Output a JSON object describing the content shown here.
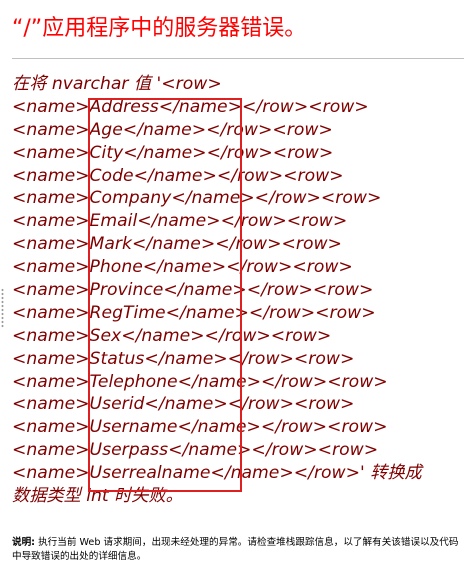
{
  "page": {
    "title": "“/”应用程序中的服务器错误。"
  },
  "error": {
    "prefix": "在将 nvarchar 值 '<row>",
    "rows": [
      {
        "name": "Address",
        "tail": "</row><row>"
      },
      {
        "name": "Age",
        "tail": "</row><row>"
      },
      {
        "name": "City",
        "tail": "</row><row>"
      },
      {
        "name": "Code",
        "tail": "</row><row>"
      },
      {
        "name": "Company",
        "tail": "</row><row>"
      },
      {
        "name": "Email",
        "tail": "</row><row>"
      },
      {
        "name": "Mark",
        "tail": "</row><row>"
      },
      {
        "name": "Phone",
        "tail": "</row><row>"
      },
      {
        "name": "Province",
        "tail": "</row><row>"
      },
      {
        "name": "RegTime",
        "tail": "</row><row>"
      },
      {
        "name": "Sex",
        "tail": "</row><row>"
      },
      {
        "name": "Status",
        "tail": "</row><row>"
      },
      {
        "name": "Telephone",
        "tail": "</row><row>"
      },
      {
        "name": "Userid",
        "tail": "</row><row>"
      },
      {
        "name": "Username",
        "tail": "</row><row>"
      },
      {
        "name": "Userpass",
        "tail": "</row><row>"
      },
      {
        "name": "Userrealname",
        "tail": "</row>' 转换成"
      }
    ],
    "suffix": "数据类型 int 时失败。",
    "open_tag": "<name>",
    "close_tag": "</name>"
  },
  "description": {
    "label": "说明:",
    "text": " 执行当前 Web 请求期间，出现未经处理的异常。请检查堆栈跟踪信息，以了解有关该错误以及代码中导致错误的出处的详细信息。"
  },
  "colors": {
    "title": "#ff0000",
    "message": "#800000",
    "highlight_box": "#e02020"
  }
}
